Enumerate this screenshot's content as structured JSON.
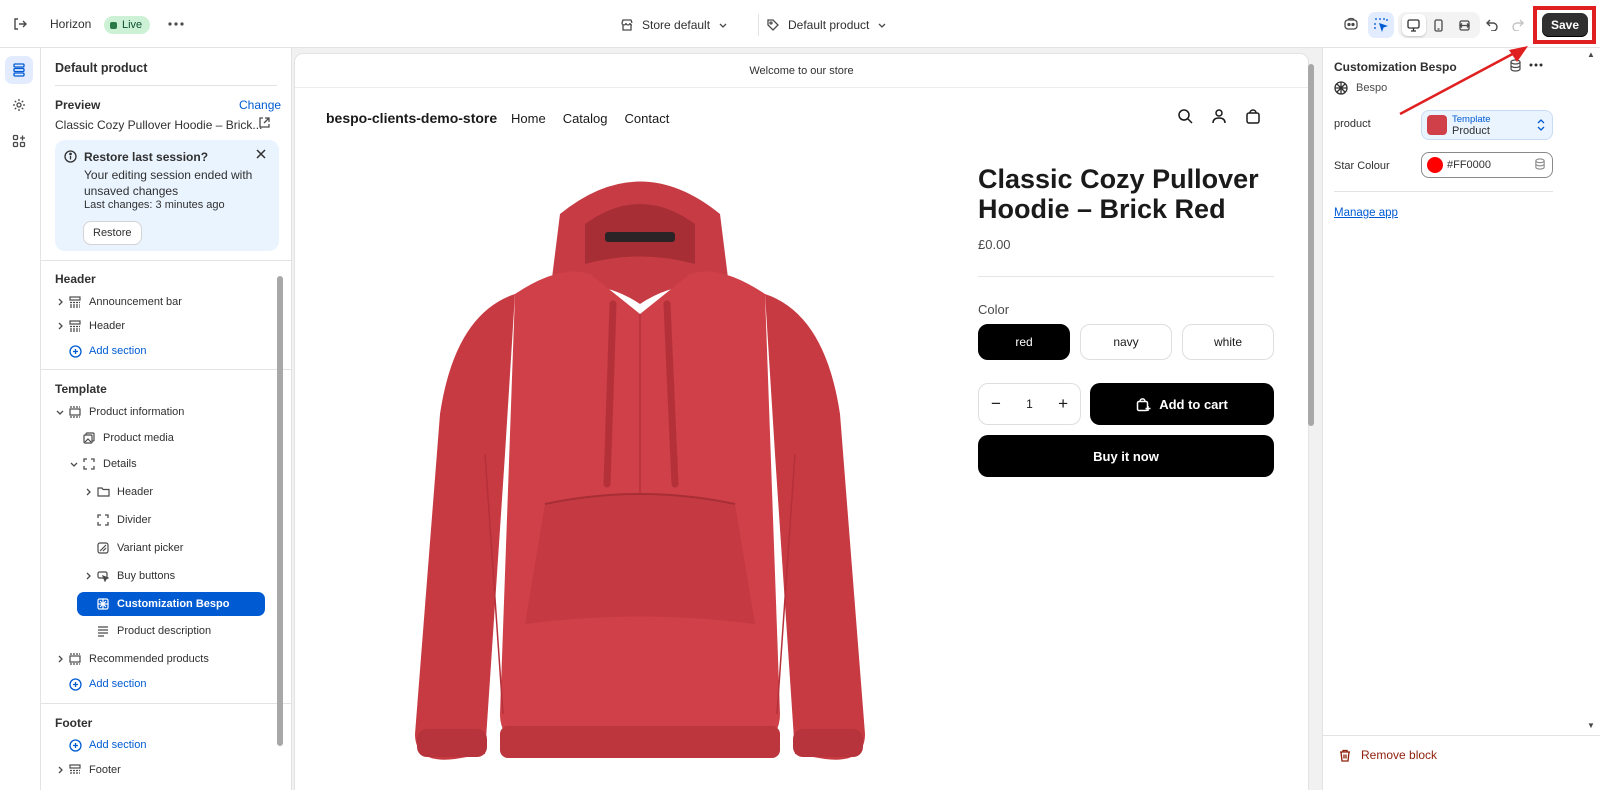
{
  "topbar": {
    "theme_name": "Horizon",
    "live_badge": "Live",
    "store_selector": "Store default",
    "template_selector": "Default product",
    "save_label": "Save"
  },
  "sidebar": {
    "title": "Default product",
    "preview_label": "Preview",
    "change_label": "Change",
    "preview_value": "Classic Cozy Pullover Hoodie – Brick...",
    "banner": {
      "title": "Restore last session?",
      "body": "Your editing session ended with unsaved changes",
      "meta": "Last changes: 3 minutes ago",
      "button": "Restore"
    },
    "groups": {
      "header": {
        "title": "Header",
        "items": [
          "Announcement bar",
          "Header"
        ],
        "add": "Add section"
      },
      "template": {
        "title": "Template",
        "product_information": "Product information",
        "product_media": "Product media",
        "details": "Details",
        "details_children": [
          "Header",
          "Divider",
          "Variant picker",
          "Buy buttons",
          "Customization Bespo",
          "Product description"
        ],
        "recommended": "Recommended products",
        "add": "Add section"
      },
      "footer": {
        "title": "Footer",
        "add": "Add section",
        "items": [
          "Footer"
        ]
      }
    }
  },
  "store": {
    "announcement": "Welcome to our store",
    "name": "bespo-clients-demo-store",
    "nav": [
      "Home",
      "Catalog",
      "Contact"
    ],
    "product": {
      "title": "Classic Cozy Pullover Hoodie – Brick Red",
      "price": "£0.00",
      "color_label": "Color",
      "colors": [
        "red",
        "navy",
        "white"
      ],
      "selected_color": "red",
      "quantity": "1",
      "add_to_cart": "Add to cart",
      "buy_now": "Buy it now",
      "image_color": "#cf4048"
    }
  },
  "settings_panel": {
    "title": "Customization Bespo",
    "app_name": "Bespo",
    "product_label": "product",
    "product_picker_type": "Template",
    "product_picker_value": "Product",
    "star_colour_label": "Star Colour",
    "star_colour_value": "#FF0000",
    "manage_app": "Manage app",
    "remove_block": "Remove block"
  },
  "colors": {
    "accent": "#005bd3",
    "annotation": "#e02020",
    "live": "#cdf1d4"
  }
}
